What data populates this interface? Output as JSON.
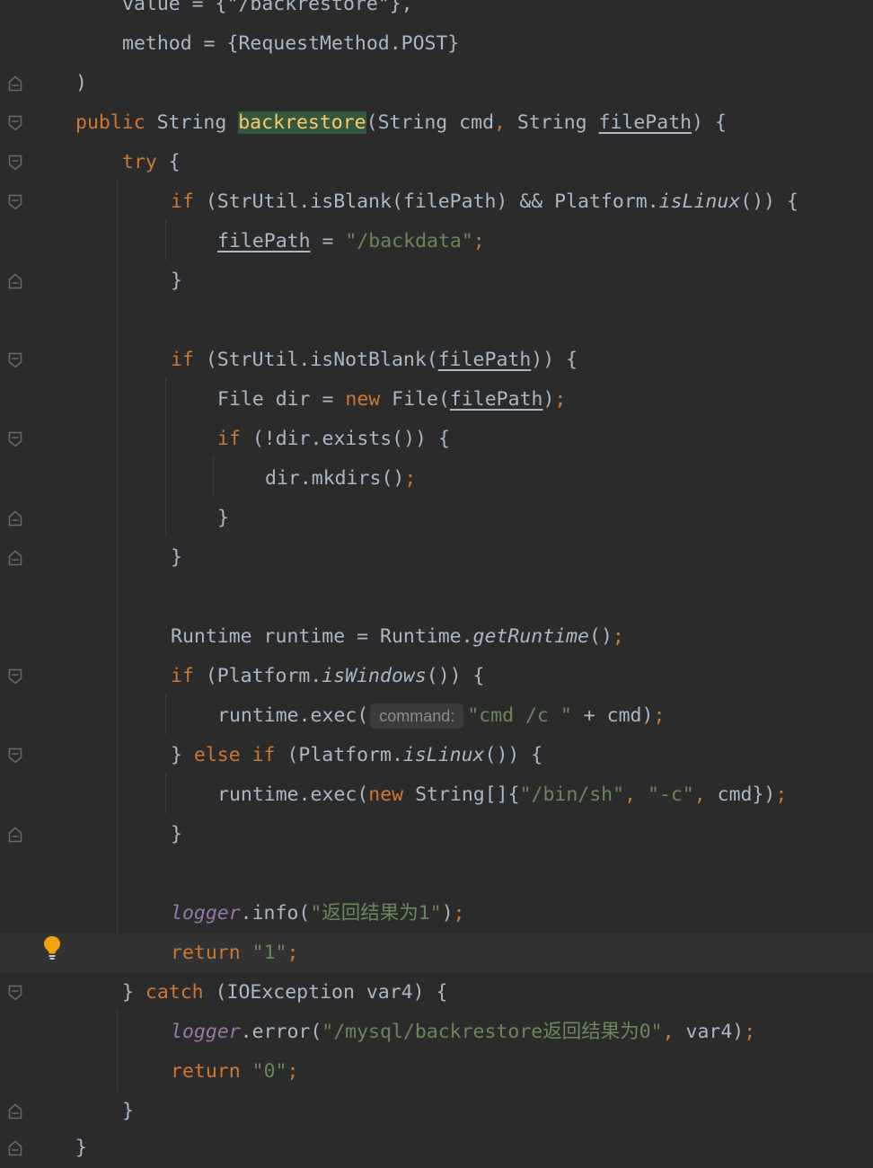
{
  "hint_label": "command:",
  "code": {
    "l0_value": "value = {\"/backrestore\"},",
    "l1_method": "method = {RequestMethod.POST}",
    "l2_close": ")",
    "l3": {
      "public": "public",
      "string1": " String ",
      "name": "backrestore",
      "args_open": "(String cmd",
      "comma": ",",
      "args_mid": " String ",
      "param": "filePath",
      "args_close": ") {"
    },
    "l4": {
      "try": "try",
      "rest": " {"
    },
    "l5": {
      "if": "if",
      "a": " (StrUtil.isBlank(filePath) && Platform.",
      "m": "isLinux",
      "b": "()) {"
    },
    "l6": {
      "var": "filePath",
      "eq": " = ",
      "str": "\"/backdata\"",
      "semi": ";"
    },
    "l7": "}",
    "l9": {
      "if": "if",
      "a": " (StrUtil.isNotBlank(",
      "var": "filePath",
      "b": ")) {"
    },
    "l10": {
      "a": "File dir = ",
      "new": "new",
      "b": " File(",
      "var": "filePath",
      "c": ")",
      "semi": ";"
    },
    "l11": {
      "if": "if",
      "a": " (!dir.exists()) {"
    },
    "l12": {
      "a": "dir.mkdirs()",
      "semi": ";"
    },
    "l13": "}",
    "l14": "}",
    "l16": {
      "a": "Runtime runtime = Runtime.",
      "m": "getRuntime",
      "b": "()",
      "semi": ";"
    },
    "l17": {
      "if": "if",
      "a": " (Platform.",
      "m": "isWindows",
      "b": "()) {"
    },
    "l18": {
      "a": "runtime.exec(",
      "str": "\"cmd /c \"",
      "b": " + cmd)",
      "semi": ";"
    },
    "l19": {
      "a": "} ",
      "else": "else if",
      "b": " (Platform.",
      "m": "isLinux",
      "c": "()) {"
    },
    "l20": {
      "a": "runtime.exec(",
      "new": "new",
      "b": " String[]{",
      "s1": "\"/bin/sh\"",
      "c1": ", ",
      "s2": "\"-c\"",
      "c2": ", ",
      "c": "cmd})",
      "semi": ";"
    },
    "l21": "}",
    "l23": {
      "field": "logger",
      "a": ".info(",
      "str": "\"返回结果为1\"",
      "b": ")",
      "semi": ";"
    },
    "l24": {
      "return": "return",
      "sp": " ",
      "str": "\"1\"",
      "semi": ";"
    },
    "l25": {
      "a": "} ",
      "catch": "catch",
      "b": " (IOException var4) {"
    },
    "l26": {
      "field": "logger",
      "a": ".error(",
      "str": "\"/mysql/backrestore返回结果为0\"",
      "comma": ",",
      "b": " var4)",
      "semi": ";"
    },
    "l27": {
      "return": "return",
      "sp": " ",
      "str": "\"0\"",
      "semi": ";"
    },
    "l28": "}",
    "l29": "}"
  },
  "colors": {
    "background": "#2b2b2b",
    "text": "#a9b7c6",
    "keyword": "#cc7832",
    "method_decl": "#ffc66d",
    "string": "#6a8759",
    "static_field": "#9876aa",
    "usage_highlight": "#32593d",
    "intention_bulb": "#f0a30a"
  },
  "icons": {
    "fold_marker": "fold-marker-icon",
    "intention_bulb": "lightbulb-icon"
  }
}
